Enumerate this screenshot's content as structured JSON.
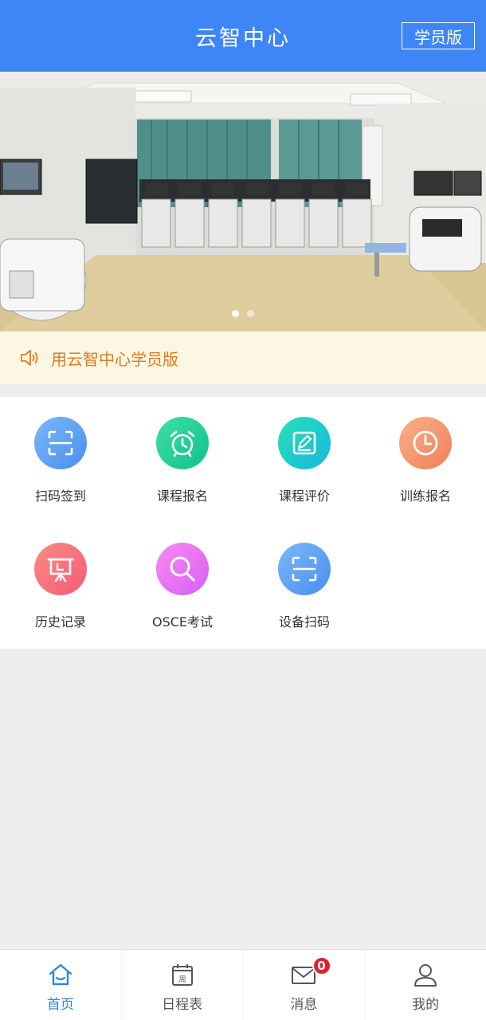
{
  "header": {
    "title": "云智中心",
    "role_button": "学员版"
  },
  "banner": {
    "image_description": "",
    "dots": 2,
    "active_dot": 0
  },
  "notice": {
    "icon": "speaker-icon",
    "text": "用云智中心学员版"
  },
  "menu": {
    "items": [
      {
        "label": "扫码签到",
        "icon": "scan-icon",
        "color": "#5a9ef3"
      },
      {
        "label": "课程报名",
        "icon": "alarm-clock-icon",
        "color": "#21cf93"
      },
      {
        "label": "课程评价",
        "icon": "edit-icon",
        "color": "#1fcbc6"
      },
      {
        "label": "训练报名",
        "icon": "clock-icon",
        "color": "#f2916a"
      },
      {
        "label": "历史记录",
        "icon": "presentation-board-icon",
        "color": "#f7707c"
      },
      {
        "label": "OSCE考试",
        "icon": "magnifier-icon",
        "color": "#e574f3"
      },
      {
        "label": "设备扫码",
        "icon": "scan-icon",
        "color": "#5a9ef3"
      }
    ]
  },
  "tabbar": {
    "tabs": [
      {
        "label": "首页",
        "icon": "home-icon",
        "active": true
      },
      {
        "label": "日程表",
        "icon": "calendar-icon",
        "active": false,
        "icon_text": "周"
      },
      {
        "label": "消息",
        "icon": "mail-icon",
        "active": false,
        "badge": "0"
      },
      {
        "label": "我的",
        "icon": "user-icon",
        "active": false
      }
    ]
  },
  "colors": {
    "primary": "#3e86f6",
    "notice_bg": "#fdf6e4",
    "notice_text": "#e07b1a",
    "tab_active": "#2f86d8",
    "badge": "#e02030"
  }
}
